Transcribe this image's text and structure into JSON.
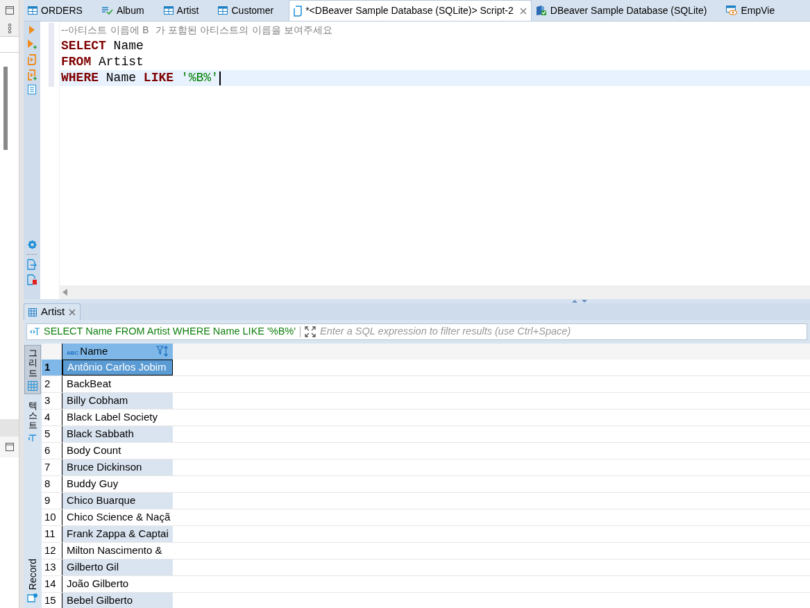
{
  "editor_tabs": [
    {
      "label": "ORDERS",
      "kind": "table",
      "selected": false
    },
    {
      "label": "Album",
      "kind": "view",
      "selected": false
    },
    {
      "label": "Artist",
      "kind": "table",
      "selected": false
    },
    {
      "label": "Customer",
      "kind": "table",
      "selected": false
    },
    {
      "label": "*<DBeaver Sample Database (SQLite)> Script-2",
      "kind": "script",
      "selected": true
    },
    {
      "label": "DBeaver Sample Database (SQLite)",
      "kind": "database",
      "selected": false
    },
    {
      "label": "EmpVie",
      "kind": "eye",
      "selected": false
    }
  ],
  "code_lines": [
    {
      "current": false,
      "tokens": [
        {
          "kind": "comment",
          "text": "--아티스트 이름에 B  가 포함된 아티스트의 이름을 보여주세요"
        }
      ]
    },
    {
      "current": false,
      "tokens": [
        {
          "kind": "keyword",
          "text": "SELECT"
        },
        {
          "kind": "plain",
          "text": "Name"
        }
      ]
    },
    {
      "current": false,
      "tokens": [
        {
          "kind": "keyword",
          "text": "FROM"
        },
        {
          "kind": "plain",
          "text": "Artist"
        }
      ]
    },
    {
      "current": true,
      "tokens": [
        {
          "kind": "keyword",
          "text": "WHERE"
        },
        {
          "kind": "plain",
          "text": "Name"
        },
        {
          "kind": "keyword",
          "text": "LIKE"
        },
        {
          "kind": "string",
          "text": "'%B%'"
        }
      ]
    }
  ],
  "results": {
    "tab": {
      "label": "Artist",
      "selected": true
    },
    "query": "SELECT Name FROM Artist WHERE Name LIKE '%B%'",
    "filter_placeholder": "Enter a SQL expression to filter results (use Ctrl+Space)",
    "side_tabs": [
      {
        "label": "그리드",
        "kind": "grid",
        "selected": true
      },
      {
        "label": "텍스트",
        "kind": "text",
        "selected": false
      },
      {
        "label": "Record",
        "kind": "record",
        "selected": false
      }
    ],
    "column": {
      "type_badge": "ABC",
      "label": "Name"
    },
    "rows": [
      {
        "num": "1",
        "name": "Antônio Carlos Jobim",
        "selected": true
      },
      {
        "num": "2",
        "name": "BackBeat",
        "selected": false
      },
      {
        "num": "3",
        "name": "Billy Cobham",
        "selected": false
      },
      {
        "num": "4",
        "name": "Black Label Society",
        "selected": false
      },
      {
        "num": "5",
        "name": "Black Sabbath",
        "selected": false
      },
      {
        "num": "6",
        "name": "Body Count",
        "selected": false
      },
      {
        "num": "7",
        "name": "Bruce Dickinson",
        "selected": false
      },
      {
        "num": "8",
        "name": "Buddy Guy",
        "selected": false
      },
      {
        "num": "9",
        "name": "Chico Buarque",
        "selected": false
      },
      {
        "num": "10",
        "name": "Chico Science & Naçã",
        "selected": false
      },
      {
        "num": "11",
        "name": "Frank Zappa & Captai",
        "selected": false
      },
      {
        "num": "12",
        "name": "Milton Nascimento &",
        "selected": false
      },
      {
        "num": "13",
        "name": "Gilberto Gil",
        "selected": false
      },
      {
        "num": "14",
        "name": "João Gilberto",
        "selected": false
      },
      {
        "num": "15",
        "name": "Bebel Gilberto",
        "selected": false
      }
    ]
  }
}
